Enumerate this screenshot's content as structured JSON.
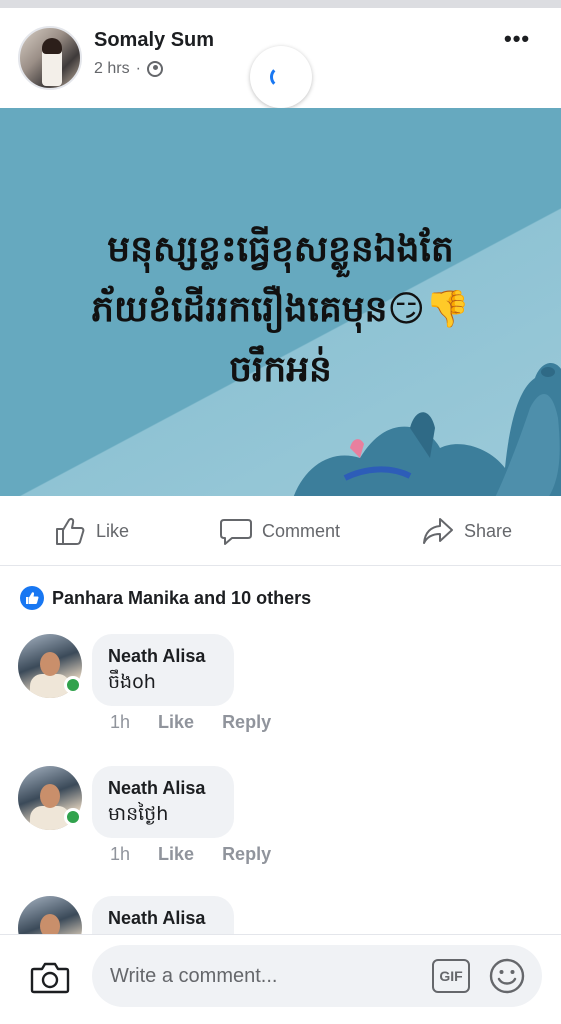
{
  "post": {
    "author_name": "Somaly Sum",
    "timestamp": "2 hrs",
    "separator": "·",
    "privacy_icon": "globe-icon",
    "more_icon": "•••",
    "image_text_lines": [
      "មនុស្សខ្លះធ្វើខុសខ្លួនឯងតែ",
      "ភ័យខំដើររករឿងគេមុន😏👎",
      "ចរឹកអន់"
    ]
  },
  "actions": {
    "like_label": "Like",
    "comment_label": "Comment",
    "share_label": "Share"
  },
  "reactions": {
    "summary": "Panhara Manika and 10 others",
    "icon": "like-badge-icon"
  },
  "comments": [
    {
      "name": "Neath Alisa",
      "text": "ចឹងoh",
      "time": "1h",
      "like_label": "Like",
      "reply_label": "Reply",
      "online": true
    },
    {
      "name": "Neath Alisa",
      "text": "មានថ្ងៃh",
      "time": "1h",
      "like_label": "Like",
      "reply_label": "Reply",
      "online": true
    },
    {
      "name": "Neath Alisa",
      "text": "",
      "time": "",
      "like_label": "",
      "reply_label": "",
      "online": false
    }
  ],
  "composer": {
    "placeholder": "Write a comment...",
    "gif_label": "GIF",
    "camera_icon": "camera-icon",
    "emoji_icon": "emoji-icon"
  },
  "colors": {
    "brand_blue": "#1877f2",
    "online_green": "#31a24c",
    "image_bg": "#66a9bf",
    "muted_text": "#65676b"
  }
}
